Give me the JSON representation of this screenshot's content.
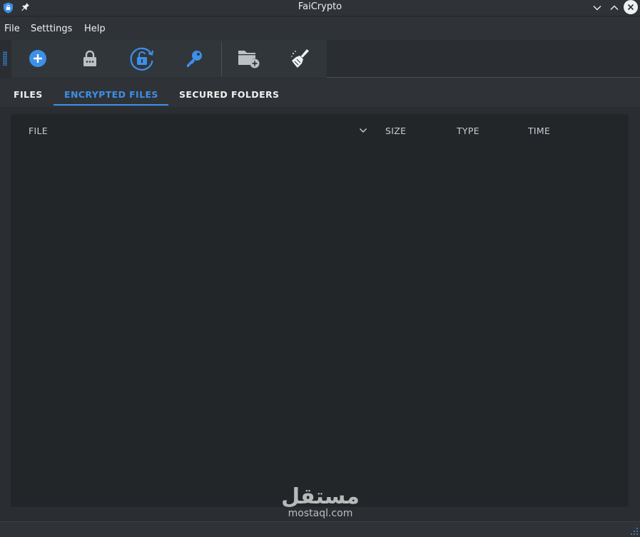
{
  "window": {
    "title": "FaiCrypto",
    "app_icon": "shield-icon",
    "pin_icon": "pin-icon",
    "controls": [
      "minimize-icon",
      "maximize-icon",
      "close-icon"
    ]
  },
  "menu": {
    "items": [
      "File",
      "Setttings",
      "Help"
    ]
  },
  "toolbar": {
    "buttons": [
      {
        "icon": "add-file-icon"
      },
      {
        "icon": "lock-icon"
      },
      {
        "icon": "decrypt-refresh-icon"
      },
      {
        "icon": "key-icon"
      },
      {
        "icon": "add-folder-icon"
      },
      {
        "icon": "clean-broom-icon"
      }
    ]
  },
  "tabs": {
    "items": [
      "FILES",
      "ENCRYPTED FILES",
      "SECURED FOLDERS"
    ],
    "active": "ENCRYPTED FILES"
  },
  "table": {
    "columns": [
      "FILE",
      "SIZE",
      "TYPE",
      "TIME"
    ],
    "rows": []
  },
  "watermark": {
    "arabic": "مستقل",
    "latin": "mostaql.com"
  },
  "colors": {
    "accent": "#3d8fe8",
    "background": "#2a2e32",
    "panel": "#232629",
    "text": "#eff0f1"
  }
}
